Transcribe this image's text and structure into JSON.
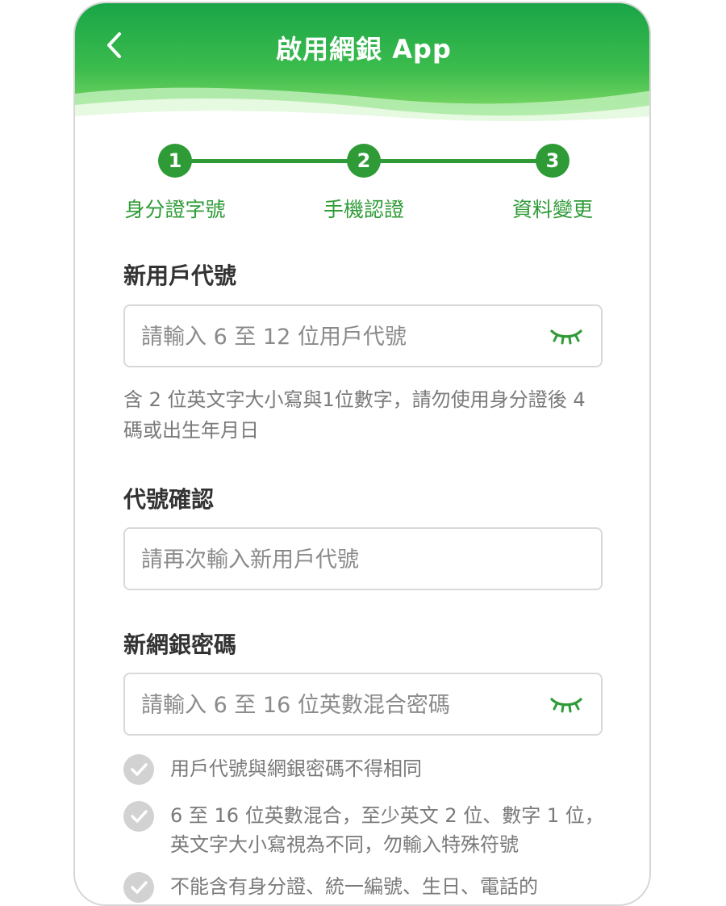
{
  "header": {
    "title": "啟用網銀 App",
    "back_icon": "chevron-left-icon"
  },
  "colors": {
    "brand_green": "#2e9b36",
    "header_gradient_top": "#1fa84a",
    "header_gradient_bottom": "#86de6a"
  },
  "stepper": {
    "steps": [
      {
        "number": "1",
        "label": "身分證字號"
      },
      {
        "number": "2",
        "label": "手機認證"
      },
      {
        "number": "3",
        "label": "資料變更"
      }
    ]
  },
  "form": {
    "user_id": {
      "label": "新用戶代號",
      "placeholder": "請輸入 6 至 12 位用戶代號",
      "value": "",
      "hint": "含 2 位英文字大小寫與1位數字，請勿使用身分證後 4 碼或出生年月日"
    },
    "user_id_confirm": {
      "label": "代號確認",
      "placeholder": "請再次輸入新用戶代號",
      "value": ""
    },
    "password": {
      "label": "新網銀密碼",
      "placeholder": "請輸入 6 至 16 位英數混合密碼",
      "value": "",
      "rules": [
        "用戶代號與網銀密碼不得相同",
        "6 至 16 位英數混合，至少英文 2 位、數字 1 位，英文字大小寫視為不同，勿輸入特殊符號",
        "不能含有身分證、統一編號、生日、電話的"
      ]
    },
    "eye_icon": "eye-closed-icon"
  }
}
